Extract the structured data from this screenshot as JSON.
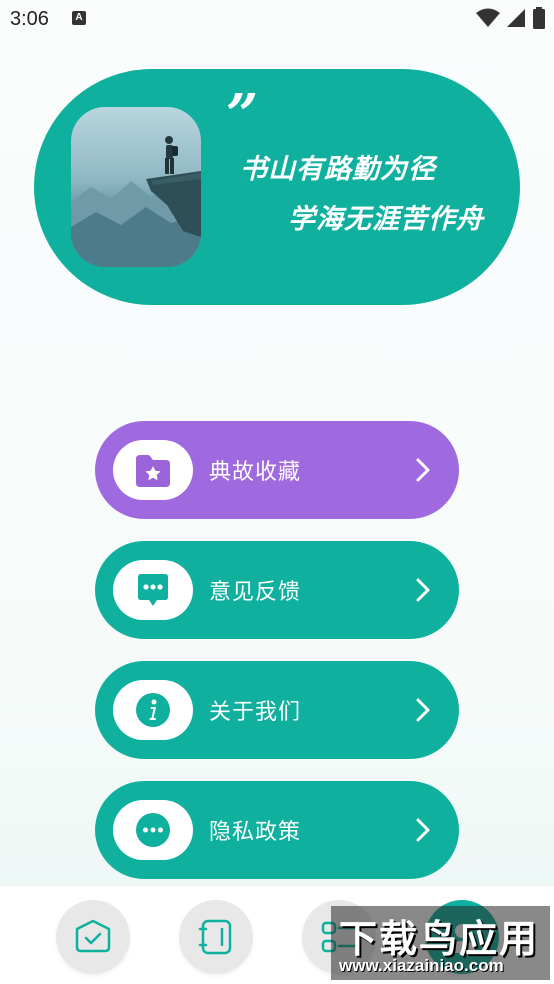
{
  "status_bar": {
    "time": "3:06",
    "notification_icon": "a-icon",
    "icons": [
      "wifi-icon",
      "signal-icon",
      "battery-icon"
    ]
  },
  "hero": {
    "quote_mark": "”",
    "line1": "书山有路勤为径",
    "line2": "学海无涯苦作舟",
    "photo": "mountain-hiker-photo"
  },
  "menu": [
    {
      "label": "典故收藏",
      "icon": "folder-star-icon",
      "color": "#9f6ae0",
      "icon_color": "#9a63d9"
    },
    {
      "label": "意见反馈",
      "icon": "chat-bubble-icon",
      "color": "#0fb09e",
      "icon_color": "#0fb09e"
    },
    {
      "label": "关于我们",
      "icon": "info-icon",
      "color": "#0fb09e",
      "icon_color": "#0fb09e"
    },
    {
      "label": "隐私政策",
      "icon": "more-icon",
      "color": "#0fb09e",
      "icon_color": "#0fb09e"
    }
  ],
  "bottom_nav": [
    {
      "name": "home",
      "icon": "box-check-icon"
    },
    {
      "name": "book",
      "icon": "notebook-icon"
    },
    {
      "name": "categories",
      "icon": "split-icon"
    },
    {
      "name": "profile",
      "icon": "user-icon",
      "active": true
    }
  ],
  "watermark": {
    "title": "下载鸟应用",
    "url": "www.xiazainiao.com"
  },
  "colors": {
    "accent": "#0fb09e",
    "purple": "#9f6ae0"
  }
}
